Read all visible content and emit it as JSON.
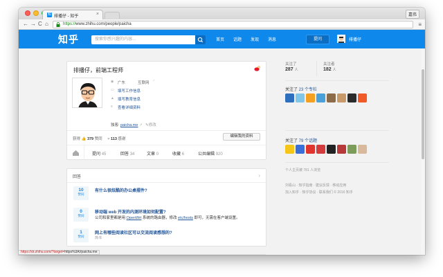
{
  "browser": {
    "tab_title": "排播仔 - 知乎",
    "tab_favicon": "知",
    "user_button": "嘉伟",
    "url_scheme": "https://",
    "url_rest": "www.zhihu.com/people/paicha",
    "status_bar_red": "https://dr.zhihu.com/?target=",
    "status_bar_text": "https%3A//paicha.me"
  },
  "header": {
    "logo": "知乎",
    "search_placeholder": "搜索你感兴趣的内容...",
    "nav": [
      "首页",
      "话题",
      "发现",
      "消息"
    ],
    "ask_label": "提问",
    "username": "排播仔"
  },
  "profile": {
    "name": "排播仔，前端工程师",
    "location": "广东",
    "industry": "互联网",
    "links": [
      "填写工作信息",
      "填写教育信息",
      "查看详细资料"
    ],
    "domain_label": "独客:",
    "domain_link": "paicha.me",
    "domain_edit": "修改",
    "stats_label": "获得",
    "agree_count": "379",
    "agree_label": "赞同",
    "thanks_count": "113",
    "thanks_label": "感谢",
    "edit_button": "编辑我的资料",
    "tabs": [
      {
        "label": "提问",
        "num": "45"
      },
      {
        "label": "回答",
        "num": "34"
      },
      {
        "label": "文章",
        "num": "0"
      },
      {
        "label": "收藏",
        "num": "6"
      },
      {
        "label": "公共编辑",
        "num": "920"
      }
    ]
  },
  "answers": {
    "title": "回答",
    "items": [
      {
        "votes": "10",
        "vote_label": "赞同",
        "title": "有什么很炫酷的办公桌摆件?",
        "excerpt_pre": "",
        "excerpt_link1": "",
        "excerpt_mid": "",
        "excerpt_link2": "",
        "excerpt_post": "",
        "meta": ""
      },
      {
        "votes": "0",
        "vote_label": "赞同",
        "title": "移动端 web 开发的内测环境如何配置?",
        "excerpt_pre": "公司和家里都是用 ",
        "excerpt_link1": "OpenWrt",
        "excerpt_mid": " 系统的路由器，修改 ",
        "excerpt_link2": "etc/hosts",
        "excerpt_post": " 即可，无需在客户端设置。",
        "meta": ""
      },
      {
        "votes": "1",
        "vote_label": "赞同",
        "title": "网上有哪些阅读社区可以交流阅读感想的?",
        "excerpt_pre": "",
        "excerpt_link1": "",
        "excerpt_mid": "",
        "excerpt_link2": "",
        "excerpt_post": "",
        "meta": "简书"
      }
    ]
  },
  "sidebar": {
    "following_label": "关注了",
    "following_num": "287",
    "followers_label": "关注者",
    "followers_num": "182",
    "unit": "人",
    "columns_pre": "关注了 ",
    "columns_num": "23",
    "columns_post": " 个专栏",
    "topics_pre": "关注了 ",
    "topics_num": "79",
    "topics_post": " 个话题",
    "homepage_views": "个人主页被 781 人浏览",
    "footer_line1": "刘看山 · 知乎指南 · 建议反馈 · 移动应用",
    "footer_line2": "加入知乎 · 知乎协议 · 联系我们 © 2016 知乎",
    "column_colors": [
      "#2c6fbf",
      "#7fc6e8",
      "#f4a020",
      "#4aa0d8",
      "#8b6b4a",
      "#c89a6a",
      "#2b2b2b",
      "#f05a28"
    ],
    "topic_colors": [
      "#f5c518",
      "#3a6fd8",
      "#e0342f",
      "#d23c3c",
      "#222222",
      "#b63a3a",
      "#7d9b5a",
      "#d9b99b"
    ]
  }
}
